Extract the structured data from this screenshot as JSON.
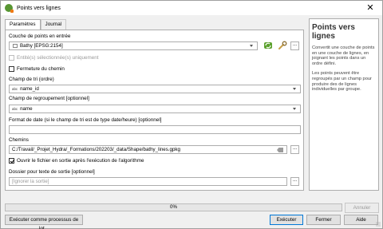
{
  "window": {
    "title": "Points vers lignes",
    "close_glyph": "✕"
  },
  "tabs": [
    {
      "label": "Paramètres"
    },
    {
      "label": "Journal"
    }
  ],
  "params": {
    "input_layer_label": "Couche de points en entrée",
    "input_layer_value": "Bathy [EPSG:2154]",
    "selected_only_label": "Entité(s) sélectionnée(s) uniquement",
    "close_path_label": "Fermeture du chemin",
    "order_label": "Champ de tri (ordre)",
    "order_value": "name_id",
    "group_label": "Champ de regroupement [optionnel]",
    "group_value": "name",
    "date_format_label": "Format de date (si le champ de tri est de type date/heure) [optionnel]",
    "date_format_value": "",
    "paths_label": "Chemins",
    "paths_value": "C:/Travail/_Projet_Hydra/_Formations/202203/_data/Shape/bathy_lines.gpkg",
    "open_output_label": "Ouvrir le fichier en sortie après l'exécution de l'algorithme",
    "text_output_label": "Dossier pour texte de sortie [optionnel]",
    "text_output_value": "[Ignorer la sortie]",
    "field_type_glyph": "abc",
    "browse_label": "..."
  },
  "help": {
    "title": "Points vers lignes",
    "p1": "Convertit une couche de points en une couche de lignes, en joignant les points dans un ordre défini.",
    "p2": "Les points peuvent être regroupés par un champ pour produire des de lignes individuelles par groupe."
  },
  "progress": {
    "value": 0,
    "label": "0%"
  },
  "buttons": {
    "batch": "Exécuter comme processus de lot...",
    "cancel": "Annuler",
    "run": "Exécuter",
    "close": "Fermer",
    "help": "Aide"
  },
  "colors": {
    "accent": "#0078d7",
    "qgis_green": "#589632"
  }
}
